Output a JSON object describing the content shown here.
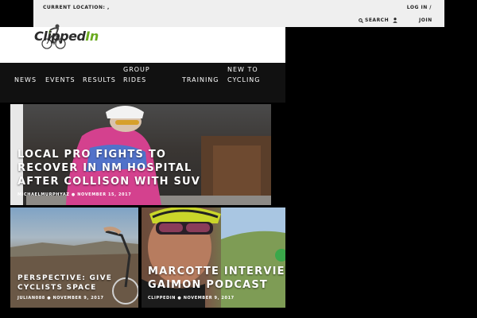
{
  "topbar": {
    "location_label": "CURRENT LOCATION: ,",
    "login_label": "LOG IN /",
    "search_label": "SEARCH",
    "join_label": "JOIN"
  },
  "logo": {
    "text_main": "Clipped",
    "text_accent": "In",
    "accent_color": "#6aaa1e"
  },
  "nav": {
    "items": [
      {
        "label": "NEWS"
      },
      {
        "label": "EVENTS"
      },
      {
        "label": "RESULTS"
      },
      {
        "label": "GROUP RIDES"
      },
      {
        "label": "TRAINING"
      },
      {
        "label": "NEW TO CYCLING"
      }
    ]
  },
  "articles": [
    {
      "title": "LOCAL PRO FIGHTS TO RECOVER IN NM HOSPITAL AFTER COLLISON WITH SUV",
      "author": "MICHAELMURPHYAZ",
      "date": "NOVEMBER 15, 2017"
    },
    {
      "title": "PERSPECTIVE: GIVE CYCLISTS SPACE",
      "author": "JULIAN088",
      "date": "NOVEMBER 9, 2017"
    },
    {
      "title": "MARCOTTE INTERVIEW ON GAIMON PODCAST",
      "author": "CLIPPEDIN",
      "date": "NOVEMBER 9, 2017"
    }
  ]
}
